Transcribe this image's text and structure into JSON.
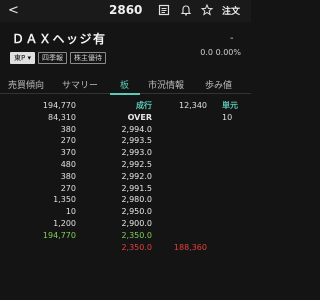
{
  "header": {
    "code": "2860",
    "order_label": "注文"
  },
  "stock": {
    "name": "ＤＡＸヘッジ有",
    "market": "東P",
    "badges": [
      "四季報",
      "株主優待"
    ],
    "price": "-",
    "change": "0.0",
    "change_pct": "0.00%"
  },
  "tabs": [
    "売買傾向",
    "サマリー",
    "板",
    "市況情報",
    "歩み値"
  ],
  "board": {
    "rows": [
      {
        "sell": "194,770",
        "price": "成行",
        "buy": "12,340",
        "right": "単元"
      },
      {
        "sell": "84,310",
        "price": "OVER",
        "buy": "",
        "right": "10"
      },
      {
        "sell": "380",
        "price": "2,994.0",
        "buy": "",
        "right": ""
      },
      {
        "sell": "270",
        "price": "2,993.5",
        "buy": "",
        "right": ""
      },
      {
        "sell": "370",
        "price": "2,993.0",
        "buy": "",
        "right": ""
      },
      {
        "sell": "480",
        "price": "2,992.5",
        "buy": "",
        "right": ""
      },
      {
        "sell": "380",
        "price": "2,992.0",
        "buy": "",
        "right": ""
      },
      {
        "sell": "270",
        "price": "2,991.5",
        "buy": "",
        "right": ""
      },
      {
        "sell": "1,350",
        "price": "2,980.0",
        "buy": "",
        "right": ""
      },
      {
        "sell": "10",
        "price": "2,950.0",
        "buy": "",
        "right": ""
      },
      {
        "sell": "1,200",
        "price": "2,900.0",
        "buy": "",
        "right": ""
      },
      {
        "sell": "194,770",
        "price": "2,350.0",
        "buy": "",
        "right": ""
      },
      {
        "sell": "",
        "price": "2,350.0",
        "buy": "188,360",
        "right": ""
      }
    ]
  },
  "colors": {
    "accent": "#5cc9b8",
    "sell_green": "#7ecf5a",
    "buy_red": "#e0413b",
    "background": "#141414"
  }
}
